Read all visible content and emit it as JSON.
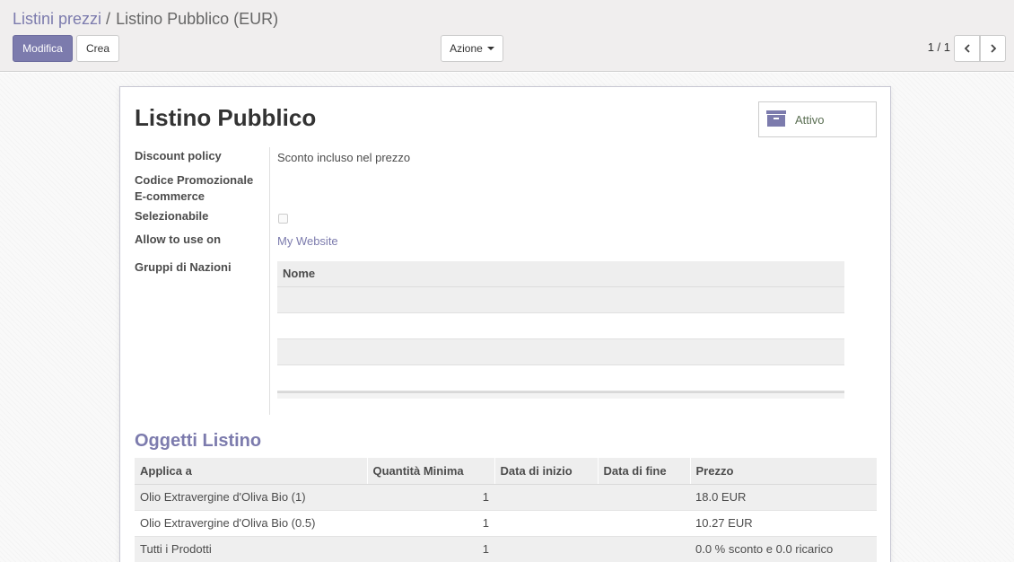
{
  "breadcrumb": {
    "parent": "Listini prezzi",
    "separator": "/",
    "current": "Listino Pubblico (EUR)"
  },
  "toolbar": {
    "edit_label": "Modifica",
    "create_label": "Crea",
    "action_label": "Azione"
  },
  "pager": {
    "value": "1 / 1"
  },
  "record": {
    "title": "Listino Pubblico",
    "status_button_label": "Attivo",
    "fields": {
      "discount_policy_label": "Discount policy",
      "discount_policy_value": "Sconto incluso nel prezzo",
      "promo_code_label_line1": "Codice Promozionale",
      "promo_code_label_line2": "E-commerce",
      "selectable_label": "Selezionabile",
      "selectable_checked": false,
      "allow_use_label": "Allow to use on",
      "allow_use_value": "My Website",
      "country_groups_label": "Gruppi di Nazioni"
    },
    "country_groups_table": {
      "header": "Nome"
    }
  },
  "pricelist_items": {
    "title": "Oggetti Listino",
    "columns": [
      "Applica a",
      "Quantità Minima",
      "Data di inizio",
      "Data di fine",
      "Prezzo"
    ],
    "rows": [
      [
        "Olio Extravergine d'Oliva Bio (1)",
        "1",
        "",
        "",
        "18.0 EUR"
      ],
      [
        "Olio Extravergine d'Oliva Bio (0.5)",
        "1",
        "",
        "",
        "10.27 EUR"
      ],
      [
        "Tutti i Prodotti",
        "1",
        "",
        "",
        "0.0 % sconto e 0.0 ricarico"
      ]
    ]
  },
  "colors": {
    "accent": "#7c7bad",
    "panel_bg": "#f0eeee"
  }
}
